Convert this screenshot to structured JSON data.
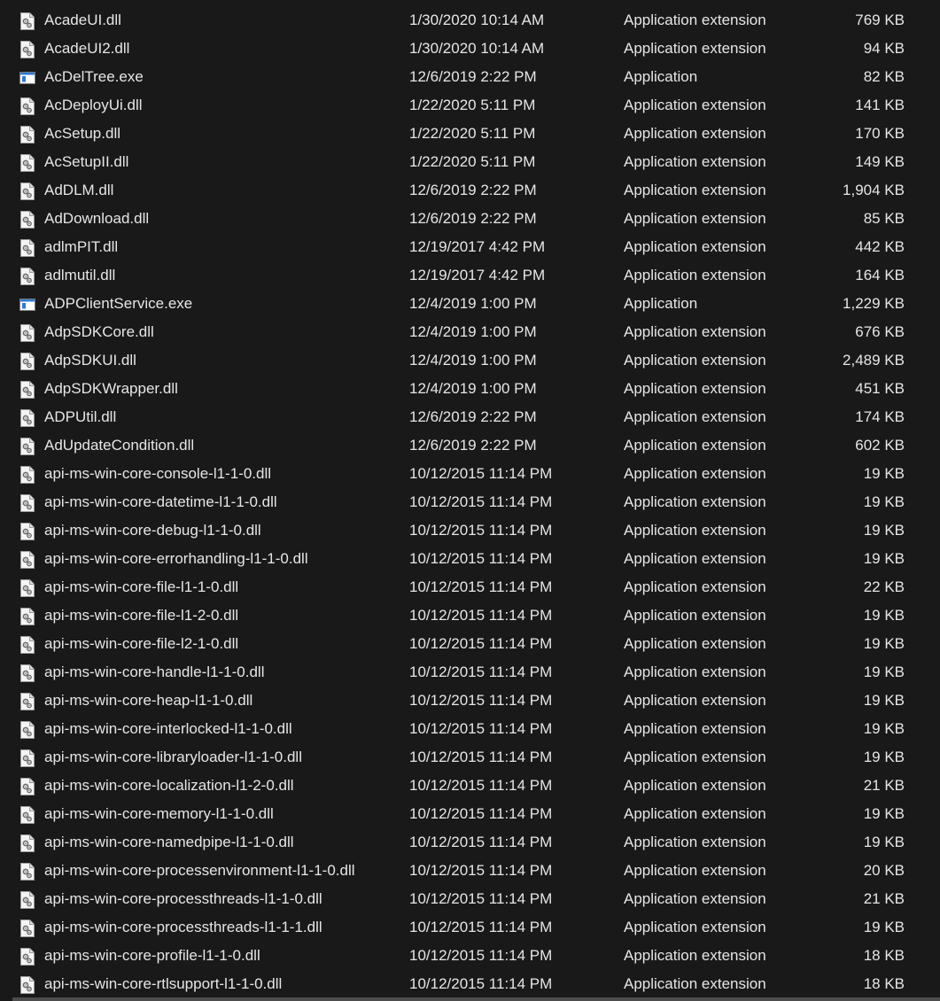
{
  "files": [
    {
      "name": "AcadeUI.dll",
      "date": "1/30/2020 10:14 AM",
      "type": "Application extension",
      "size": "769 KB",
      "icon": "dll-file-icon"
    },
    {
      "name": "AcadeUI2.dll",
      "date": "1/30/2020 10:14 AM",
      "type": "Application extension",
      "size": "94 KB",
      "icon": "dll-file-icon"
    },
    {
      "name": "AcDelTree.exe",
      "date": "12/6/2019 2:22 PM",
      "type": "Application",
      "size": "82 KB",
      "icon": "exe-file-icon"
    },
    {
      "name": "AcDeployUi.dll",
      "date": "1/22/2020 5:11 PM",
      "type": "Application extension",
      "size": "141 KB",
      "icon": "dll-file-icon"
    },
    {
      "name": "AcSetup.dll",
      "date": "1/22/2020 5:11 PM",
      "type": "Application extension",
      "size": "170 KB",
      "icon": "dll-file-icon"
    },
    {
      "name": "AcSetupII.dll",
      "date": "1/22/2020 5:11 PM",
      "type": "Application extension",
      "size": "149 KB",
      "icon": "dll-file-icon"
    },
    {
      "name": "AdDLM.dll",
      "date": "12/6/2019 2:22 PM",
      "type": "Application extension",
      "size": "1,904 KB",
      "icon": "dll-file-icon"
    },
    {
      "name": "AdDownload.dll",
      "date": "12/6/2019 2:22 PM",
      "type": "Application extension",
      "size": "85 KB",
      "icon": "dll-file-icon"
    },
    {
      "name": "adlmPIT.dll",
      "date": "12/19/2017 4:42 PM",
      "type": "Application extension",
      "size": "442 KB",
      "icon": "dll-file-icon"
    },
    {
      "name": "adlmutil.dll",
      "date": "12/19/2017 4:42 PM",
      "type": "Application extension",
      "size": "164 KB",
      "icon": "dll-file-icon"
    },
    {
      "name": "ADPClientService.exe",
      "date": "12/4/2019 1:00 PM",
      "type": "Application",
      "size": "1,229 KB",
      "icon": "exe-file-icon"
    },
    {
      "name": "AdpSDKCore.dll",
      "date": "12/4/2019 1:00 PM",
      "type": "Application extension",
      "size": "676 KB",
      "icon": "dll-file-icon"
    },
    {
      "name": "AdpSDKUI.dll",
      "date": "12/4/2019 1:00 PM",
      "type": "Application extension",
      "size": "2,489 KB",
      "icon": "dll-file-icon"
    },
    {
      "name": "AdpSDKWrapper.dll",
      "date": "12/4/2019 1:00 PM",
      "type": "Application extension",
      "size": "451 KB",
      "icon": "dll-file-icon"
    },
    {
      "name": "ADPUtil.dll",
      "date": "12/6/2019 2:22 PM",
      "type": "Application extension",
      "size": "174 KB",
      "icon": "dll-file-icon"
    },
    {
      "name": "AdUpdateCondition.dll",
      "date": "12/6/2019 2:22 PM",
      "type": "Application extension",
      "size": "602 KB",
      "icon": "dll-file-icon"
    },
    {
      "name": "api-ms-win-core-console-l1-1-0.dll",
      "date": "10/12/2015 11:14 PM",
      "type": "Application extension",
      "size": "19 KB",
      "icon": "dll-file-icon"
    },
    {
      "name": "api-ms-win-core-datetime-l1-1-0.dll",
      "date": "10/12/2015 11:14 PM",
      "type": "Application extension",
      "size": "19 KB",
      "icon": "dll-file-icon"
    },
    {
      "name": "api-ms-win-core-debug-l1-1-0.dll",
      "date": "10/12/2015 11:14 PM",
      "type": "Application extension",
      "size": "19 KB",
      "icon": "dll-file-icon"
    },
    {
      "name": "api-ms-win-core-errorhandling-l1-1-0.dll",
      "date": "10/12/2015 11:14 PM",
      "type": "Application extension",
      "size": "19 KB",
      "icon": "dll-file-icon"
    },
    {
      "name": "api-ms-win-core-file-l1-1-0.dll",
      "date": "10/12/2015 11:14 PM",
      "type": "Application extension",
      "size": "22 KB",
      "icon": "dll-file-icon"
    },
    {
      "name": "api-ms-win-core-file-l1-2-0.dll",
      "date": "10/12/2015 11:14 PM",
      "type": "Application extension",
      "size": "19 KB",
      "icon": "dll-file-icon"
    },
    {
      "name": "api-ms-win-core-file-l2-1-0.dll",
      "date": "10/12/2015 11:14 PM",
      "type": "Application extension",
      "size": "19 KB",
      "icon": "dll-file-icon"
    },
    {
      "name": "api-ms-win-core-handle-l1-1-0.dll",
      "date": "10/12/2015 11:14 PM",
      "type": "Application extension",
      "size": "19 KB",
      "icon": "dll-file-icon"
    },
    {
      "name": "api-ms-win-core-heap-l1-1-0.dll",
      "date": "10/12/2015 11:14 PM",
      "type": "Application extension",
      "size": "19 KB",
      "icon": "dll-file-icon"
    },
    {
      "name": "api-ms-win-core-interlocked-l1-1-0.dll",
      "date": "10/12/2015 11:14 PM",
      "type": "Application extension",
      "size": "19 KB",
      "icon": "dll-file-icon"
    },
    {
      "name": "api-ms-win-core-libraryloader-l1-1-0.dll",
      "date": "10/12/2015 11:14 PM",
      "type": "Application extension",
      "size": "19 KB",
      "icon": "dll-file-icon"
    },
    {
      "name": "api-ms-win-core-localization-l1-2-0.dll",
      "date": "10/12/2015 11:14 PM",
      "type": "Application extension",
      "size": "21 KB",
      "icon": "dll-file-icon"
    },
    {
      "name": "api-ms-win-core-memory-l1-1-0.dll",
      "date": "10/12/2015 11:14 PM",
      "type": "Application extension",
      "size": "19 KB",
      "icon": "dll-file-icon"
    },
    {
      "name": "api-ms-win-core-namedpipe-l1-1-0.dll",
      "date": "10/12/2015 11:14 PM",
      "type": "Application extension",
      "size": "19 KB",
      "icon": "dll-file-icon"
    },
    {
      "name": "api-ms-win-core-processenvironment-l1-1-0.dll",
      "date": "10/12/2015 11:14 PM",
      "type": "Application extension",
      "size": "20 KB",
      "icon": "dll-file-icon"
    },
    {
      "name": "api-ms-win-core-processthreads-l1-1-0.dll",
      "date": "10/12/2015 11:14 PM",
      "type": "Application extension",
      "size": "21 KB",
      "icon": "dll-file-icon"
    },
    {
      "name": "api-ms-win-core-processthreads-l1-1-1.dll",
      "date": "10/12/2015 11:14 PM",
      "type": "Application extension",
      "size": "19 KB",
      "icon": "dll-file-icon"
    },
    {
      "name": "api-ms-win-core-profile-l1-1-0.dll",
      "date": "10/12/2015 11:14 PM",
      "type": "Application extension",
      "size": "18 KB",
      "icon": "dll-file-icon"
    },
    {
      "name": "api-ms-win-core-rtlsupport-l1-1-0.dll",
      "date": "10/12/2015 11:14 PM",
      "type": "Application extension",
      "size": "18 KB",
      "icon": "dll-file-icon"
    }
  ],
  "colors": {
    "background": "#191919",
    "text": "#e6e6e6",
    "scrollbar_thumb": "#4d4d4d"
  }
}
